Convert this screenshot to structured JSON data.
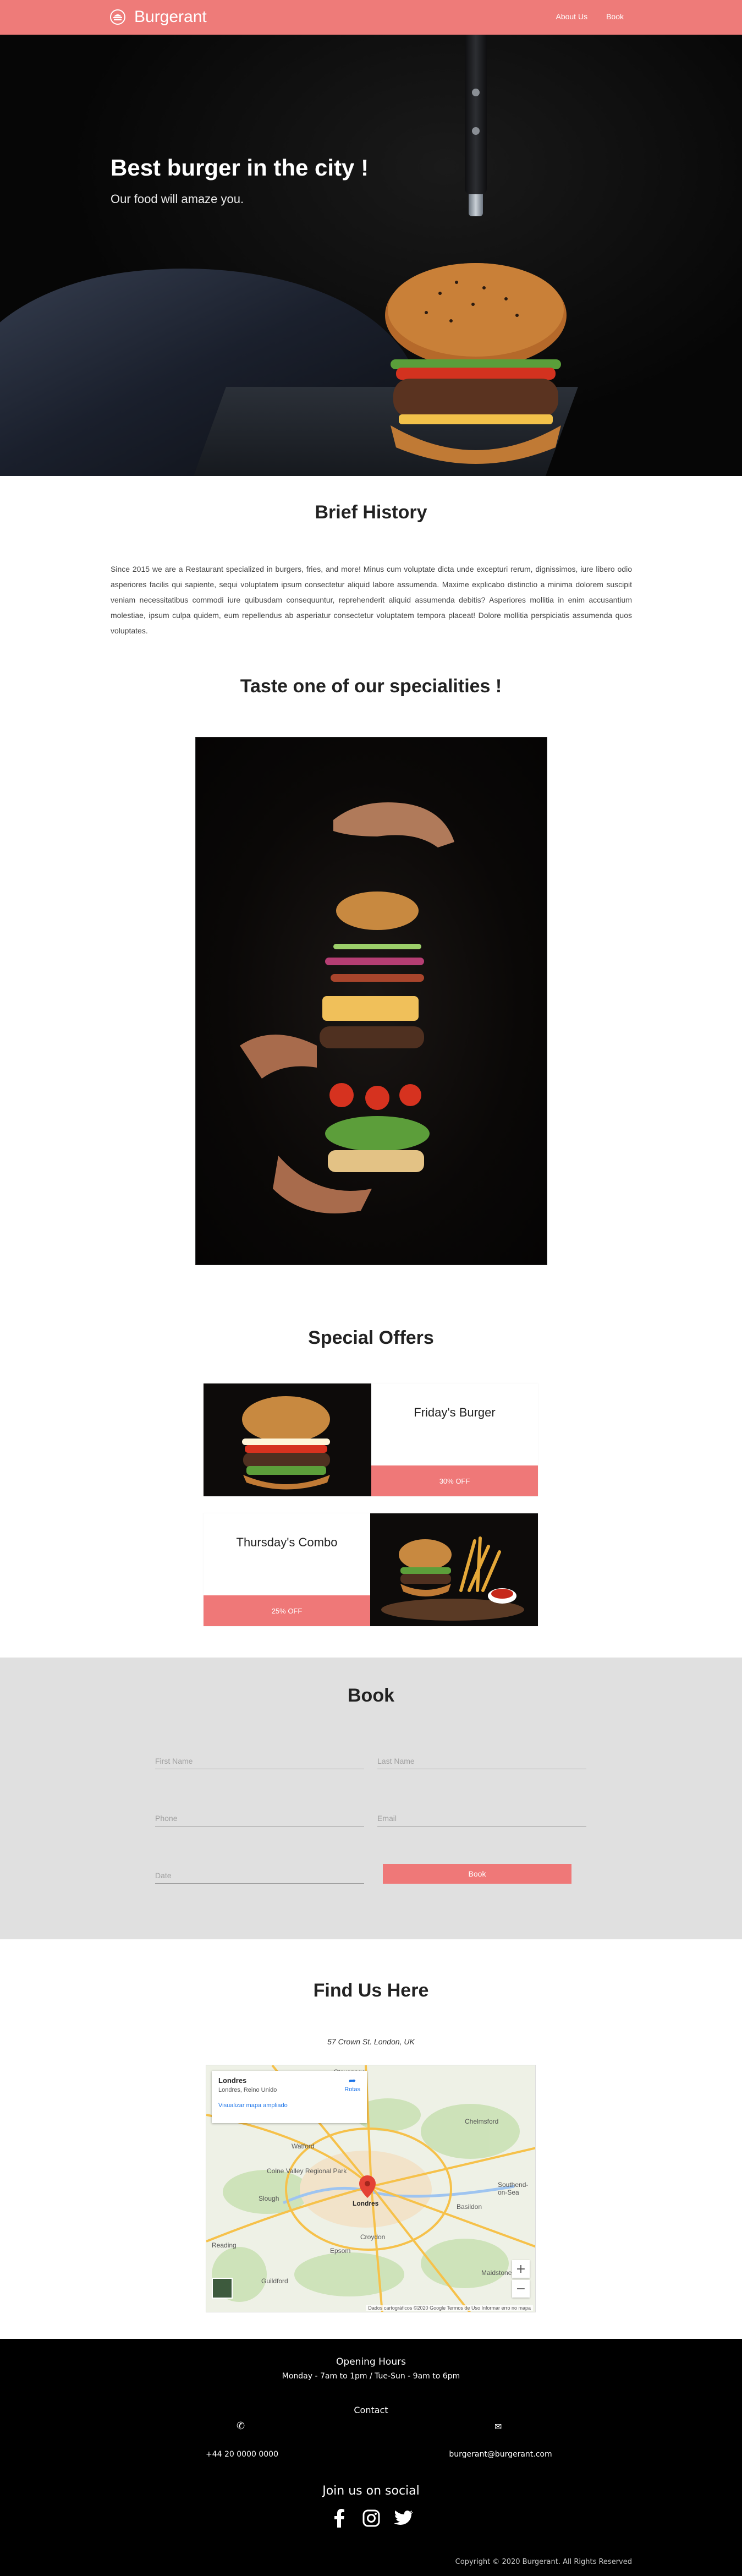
{
  "nav": {
    "brand": "Burgerant",
    "links": [
      "About Us",
      "Book"
    ]
  },
  "hero": {
    "title": "Best burger in the city !",
    "subtitle": "Our food will amaze you."
  },
  "history": {
    "title": "Brief History",
    "text": "Since 2015 we are a Restaurant specialized in burgers, fries, and more! Minus cum voluptate dicta unde excepturi rerum, dignissimos, iure libero odio asperiores facilis qui sapiente, sequi voluptatem ipsum consectetur aliquid labore assumenda. Maxime explicabo distinctio a minima dolorem suscipit veniam necessitatibus commodi iure quibusdam consequuntur, reprehenderit aliquid assumenda debitis? Asperiores mollitia in enim accusantium molestiae, ipsum culpa quidem, eum repellendus ab asperiatur consectetur voluptatem tempora placeat! Dolore mollitia perspiciatis assumenda quos voluptates."
  },
  "speciality": {
    "title": "Taste one of our specialities !"
  },
  "offers": {
    "title": "Special Offers",
    "items": [
      {
        "name": "Friday's Burger",
        "discount": "30% OFF"
      },
      {
        "name": "Thursday's Combo",
        "discount": "25% OFF"
      }
    ]
  },
  "book": {
    "title": "Book",
    "first_name": "First Name",
    "last_name": "Last Name",
    "phone": "Phone",
    "email": "Email",
    "date": "Date",
    "submit": "Book"
  },
  "find": {
    "title": "Find Us Here",
    "address": "57 Crown St. London, UK",
    "map": {
      "place": "Londres",
      "place_sub": "Londres, Reino Unido",
      "larger_map": "Visualizar mapa ampliado",
      "directions": "Rotas",
      "city_label": "Londres",
      "labels": [
        "Stevenage",
        "Chelmsford",
        "Watford",
        "Slough",
        "Croydon",
        "Guildford",
        "Maidstone",
        "Southend-on-Sea",
        "Reading",
        "Colne Valley Regional Park",
        "Basildon",
        "Epsom"
      ],
      "zoom_in": "+",
      "zoom_out": "−",
      "footer": "Dados cartográficos ©2020 Google   Termos de Uso   Informar erro no mapa"
    }
  },
  "footer": {
    "hours_title": "Opening Hours",
    "hours": "Monday - 7am to 1pm / Tue-Sun - 9am to 6pm",
    "contact_title": "Contact",
    "phone": "+44 20 0000 0000",
    "email": "burgerant@burgerant.com",
    "social_title": "Join us on social",
    "social": [
      "facebook-icon",
      "instagram-icon",
      "twitter-icon"
    ],
    "copyright": "Copyright © 2020 Burgerant. All Rights Reserved"
  },
  "colors": {
    "accent": "#ee7b79",
    "book_bg": "#e0e0e0",
    "footer_bg": "#000000"
  }
}
